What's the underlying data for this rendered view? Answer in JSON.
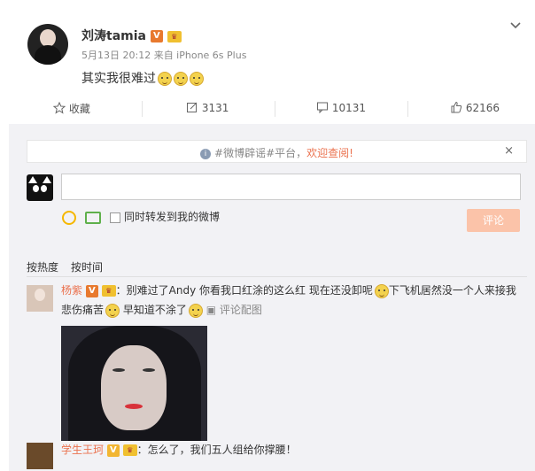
{
  "post": {
    "username": "刘涛tamia",
    "verified_badge": "V",
    "meta": "5月13日 20:12 来自 iPhone 6s Plus",
    "text": "其实我很难过"
  },
  "actions": {
    "favorite": "收藏",
    "repost_count": "3131",
    "comment_count": "10131",
    "like_count": "62166"
  },
  "notice": {
    "prefix": "#微博辟谣#平台，",
    "link": "欢迎查阅!",
    "close": "×"
  },
  "composer": {
    "input_value": "",
    "repost_label": "同时转发到我的微博",
    "submit_label": "评论"
  },
  "sort": {
    "hot": "按热度",
    "time": "按时间"
  },
  "comments": [
    {
      "name": "杨紫",
      "badge": "V",
      "text_a": "：别难过了Andy 你看我口红涂的这么红 现在还没卸呢",
      "text_b": "下飞机居然没一个人来接我",
      "text_c": "悲伤痛苦",
      "text_d": "早知道不涂了",
      "action": "评论配图"
    },
    {
      "name": "学生王珂",
      "badge": "V",
      "text": "：怎么了，我们五人组给你撑腰！"
    }
  ],
  "colors": {
    "accent": "#eb7350",
    "badge": "#e8792e",
    "submit_disabled": "#fbc3a9",
    "panel_bg": "#f2f2f5"
  },
  "icons": [
    "collapse-chevron-icon",
    "star-icon",
    "repost-icon",
    "comment-icon",
    "like-icon",
    "info-icon",
    "emoji-icon",
    "picture-icon"
  ]
}
